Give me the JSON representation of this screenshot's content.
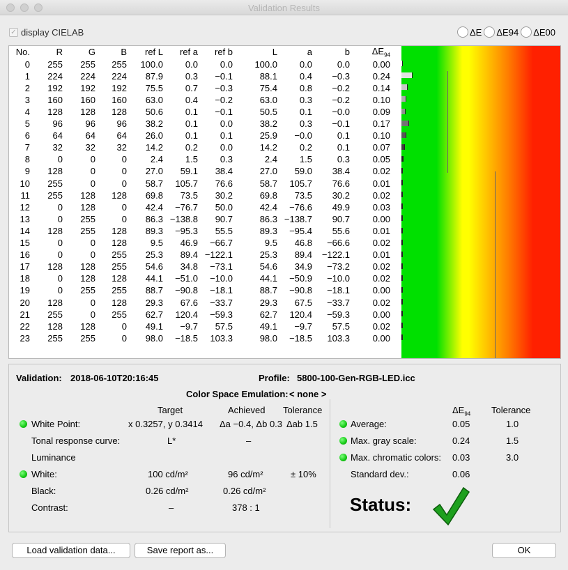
{
  "window": {
    "title": "Validation Results"
  },
  "options": {
    "cielab_label": "display CIELAB",
    "metrics": [
      "ΔE",
      "ΔE94",
      "ΔE00"
    ]
  },
  "table": {
    "headers": [
      "No.",
      "R",
      "G",
      "B",
      "ref L",
      "ref a",
      "ref b",
      "L",
      "a",
      "b",
      "ΔE"
    ],
    "dE_sub": "94",
    "rows": [
      [
        "0",
        "255",
        "255",
        "255",
        "100.0",
        "0.0",
        "0.0",
        "100.0",
        "0.0",
        "0.0",
        "0.00"
      ],
      [
        "1",
        "224",
        "224",
        "224",
        "87.9",
        "0.3",
        "−0.1",
        "88.1",
        "0.4",
        "−0.3",
        "0.24"
      ],
      [
        "2",
        "192",
        "192",
        "192",
        "75.5",
        "0.7",
        "−0.3",
        "75.4",
        "0.8",
        "−0.2",
        "0.14"
      ],
      [
        "3",
        "160",
        "160",
        "160",
        "63.0",
        "0.4",
        "−0.2",
        "63.0",
        "0.3",
        "−0.2",
        "0.10"
      ],
      [
        "4",
        "128",
        "128",
        "128",
        "50.6",
        "0.1",
        "−0.1",
        "50.5",
        "0.1",
        "−0.0",
        "0.09"
      ],
      [
        "5",
        "96",
        "96",
        "96",
        "38.2",
        "0.1",
        "0.0",
        "38.2",
        "0.3",
        "−0.1",
        "0.17"
      ],
      [
        "6",
        "64",
        "64",
        "64",
        "26.0",
        "0.1",
        "0.1",
        "25.9",
        "−0.0",
        "0.1",
        "0.10"
      ],
      [
        "7",
        "32",
        "32",
        "32",
        "14.2",
        "0.2",
        "0.0",
        "14.2",
        "0.2",
        "0.1",
        "0.07"
      ],
      [
        "8",
        "0",
        "0",
        "0",
        "2.4",
        "1.5",
        "0.3",
        "2.4",
        "1.5",
        "0.3",
        "0.05"
      ],
      [
        "9",
        "128",
        "0",
        "0",
        "27.0",
        "59.1",
        "38.4",
        "27.0",
        "59.0",
        "38.4",
        "0.02"
      ],
      [
        "10",
        "255",
        "0",
        "0",
        "58.7",
        "105.7",
        "76.6",
        "58.7",
        "105.7",
        "76.6",
        "0.01"
      ],
      [
        "11",
        "255",
        "128",
        "128",
        "69.8",
        "73.5",
        "30.2",
        "69.8",
        "73.5",
        "30.2",
        "0.02"
      ],
      [
        "12",
        "0",
        "128",
        "0",
        "42.4",
        "−76.7",
        "50.0",
        "42.4",
        "−76.6",
        "49.9",
        "0.03"
      ],
      [
        "13",
        "0",
        "255",
        "0",
        "86.3",
        "−138.8",
        "90.7",
        "86.3",
        "−138.7",
        "90.7",
        "0.00"
      ],
      [
        "14",
        "128",
        "255",
        "128",
        "89.3",
        "−95.3",
        "55.5",
        "89.3",
        "−95.4",
        "55.6",
        "0.01"
      ],
      [
        "15",
        "0",
        "0",
        "128",
        "9.5",
        "46.9",
        "−66.7",
        "9.5",
        "46.8",
        "−66.6",
        "0.02"
      ],
      [
        "16",
        "0",
        "0",
        "255",
        "25.3",
        "89.4",
        "−122.1",
        "25.3",
        "89.4",
        "−122.1",
        "0.01"
      ],
      [
        "17",
        "128",
        "128",
        "255",
        "54.6",
        "34.8",
        "−73.1",
        "54.6",
        "34.9",
        "−73.2",
        "0.02"
      ],
      [
        "18",
        "0",
        "128",
        "128",
        "44.1",
        "−51.0",
        "−10.0",
        "44.1",
        "−50.9",
        "−10.0",
        "0.02"
      ],
      [
        "19",
        "0",
        "255",
        "255",
        "88.7",
        "−90.8",
        "−18.1",
        "88.7",
        "−90.8",
        "−18.1",
        "0.00"
      ],
      [
        "20",
        "128",
        "0",
        "128",
        "29.3",
        "67.6",
        "−33.7",
        "29.3",
        "67.5",
        "−33.7",
        "0.02"
      ],
      [
        "21",
        "255",
        "0",
        "255",
        "62.7",
        "120.4",
        "−59.3",
        "62.7",
        "120.4",
        "−59.3",
        "0.00"
      ],
      [
        "22",
        "128",
        "128",
        "0",
        "49.1",
        "−9.7",
        "57.5",
        "49.1",
        "−9.7",
        "57.5",
        "0.02"
      ],
      [
        "23",
        "255",
        "255",
        "0",
        "98.0",
        "−18.5",
        "103.3",
        "98.0",
        "−18.5",
        "103.3",
        "0.00"
      ]
    ],
    "gradient_colors": [
      "#00e000",
      "#ffff00",
      "#ff8000",
      "#ff2000"
    ]
  },
  "summary": {
    "validation_label": "Validation:",
    "validation_value": "2018-06-10T20:16:45",
    "profile_label": "Profile:",
    "profile_value": "5800-100-Gen-RGB-LED.icc",
    "emulation_label": "Color Space Emulation:",
    "emulation_value": "< none >",
    "col_target": "Target",
    "col_achieved": "Achieved",
    "col_tolerance": "Tolerance",
    "white_point": {
      "label": "White Point:",
      "target": "x 0.3257, y 0.3414",
      "achieved": "Δa −0.4, Δb 0.3",
      "tolerance": "Δab 1.5"
    },
    "trc": {
      "label": "Tonal response curve:",
      "target": "L*",
      "achieved": "–"
    },
    "luminance_label": "Luminance",
    "white": {
      "label": "White:",
      "target": "100 cd/m²",
      "achieved": "96 cd/m²",
      "tolerance": "± 10%"
    },
    "black": {
      "label": "Black:",
      "target": "0.26 cd/m²",
      "achieved": "0.26 cd/m²"
    },
    "contrast": {
      "label": "Contrast:",
      "target": "–",
      "achieved": "378 : 1"
    },
    "right": {
      "col_de": "ΔE",
      "col_de_sub": "94",
      "col_tolerance": "Tolerance",
      "average": {
        "label": "Average:",
        "value": "0.05",
        "tolerance": "1.0"
      },
      "gray": {
        "label": "Max. gray scale:",
        "value": "0.24",
        "tolerance": "1.5"
      },
      "chromatic": {
        "label": "Max. chromatic colors:",
        "value": "0.03",
        "tolerance": "3.0"
      },
      "stddev": {
        "label": "Standard dev.:",
        "value": "0.06"
      }
    },
    "status_label": "Status:",
    "status_color": "#1ea01e"
  },
  "buttons": {
    "load": "Load validation data...",
    "save": "Save report as...",
    "ok": "OK"
  }
}
